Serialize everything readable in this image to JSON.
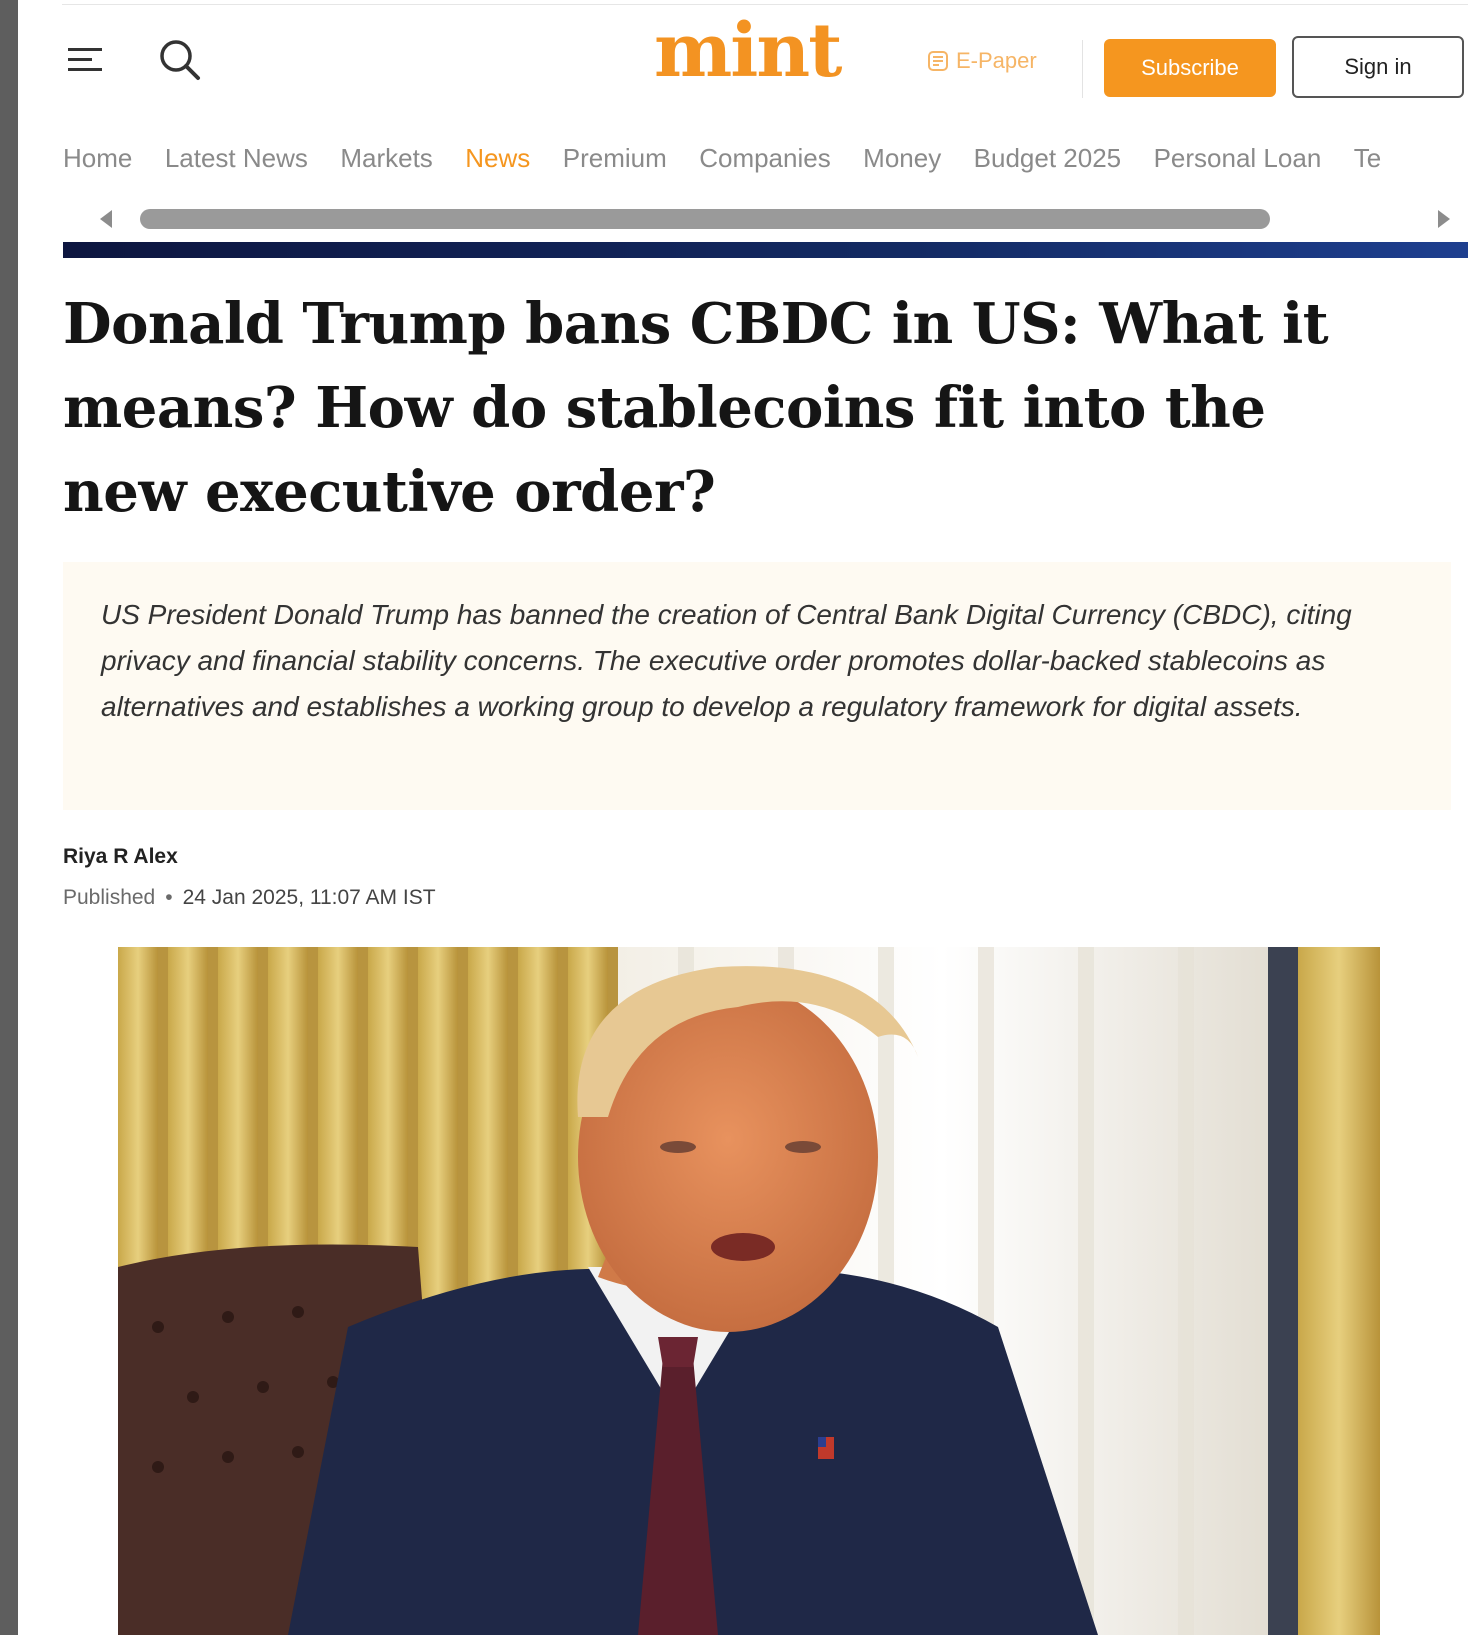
{
  "header": {
    "logo_text": "mint",
    "epaper_label": "E-Paper",
    "subscribe_label": "Subscribe",
    "signin_label": "Sign in",
    "accent_color": "#f5961f",
    "icons": [
      "menu-icon",
      "search-icon",
      "epaper-icon"
    ]
  },
  "nav": {
    "items": [
      {
        "label": "Home"
      },
      {
        "label": "Latest News"
      },
      {
        "label": "Markets"
      },
      {
        "label": "News",
        "active": true
      },
      {
        "label": "Premium"
      },
      {
        "label": "Companies"
      },
      {
        "label": "Money"
      },
      {
        "label": "Budget 2025"
      },
      {
        "label": "Personal Loan"
      },
      {
        "label": "Te"
      }
    ]
  },
  "article": {
    "headline": "Donald Trump bans CBDC in US: What it means? How do stablecoins fit into the new executive order?",
    "summary": "US President Donald Trump has banned the creation of Central Bank Digital Currency (CBDC), citing privacy and financial stability concerns. The executive order promotes dollar-backed stablecoins as alternatives and establishes a working group to develop a regulatory framework for digital assets.",
    "author": "Riya R Alex",
    "published_label": "Published",
    "published_date": "24 Jan 2025, 11:07 AM IST",
    "image_subject": "news-photo-of-donald-trump"
  }
}
